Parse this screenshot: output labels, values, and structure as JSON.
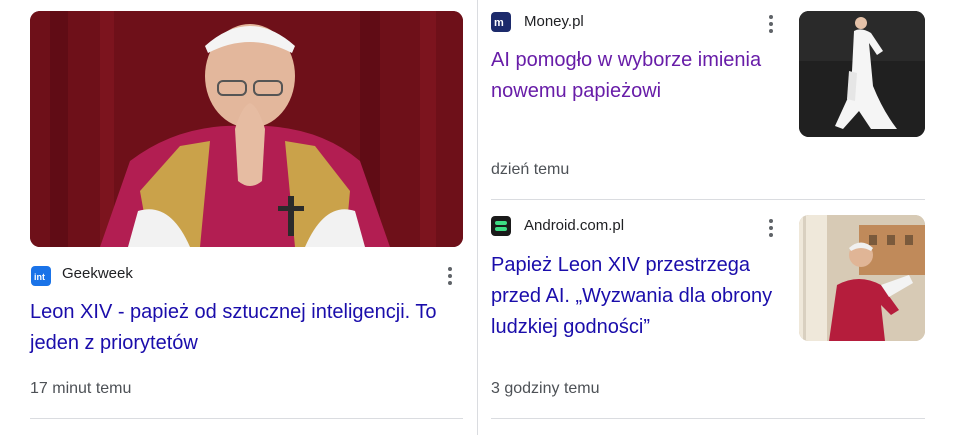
{
  "cards": [
    {
      "source": "Geekweek",
      "source_icon": "geekweek-logo-icon",
      "title": "Leon XIV - papież od sztucznej inteligencji. To jeden z priorytetów",
      "time": "17 minut temu",
      "image": "pope-praying-photo"
    },
    {
      "source": "Money.pl",
      "source_icon": "money-pl-logo-icon",
      "title": "AI pomogło w wyborze imienia nowemu papieżowi",
      "time": "dzień temu",
      "image": "pope-walking-photo"
    },
    {
      "source": "Android.com.pl",
      "source_icon": "android-com-pl-logo-icon",
      "title": "Papież Leon XIV przestrzega przed AI. „Wyzwania dla obrony ludzkiej godności”",
      "time": "3 godziny temu",
      "image": "pope-balcony-photo"
    }
  ],
  "colors": {
    "link": "#1a0dab",
    "visited_link": "#681da8",
    "meta_text": "#4d5156",
    "divider": "#dadce0"
  },
  "menu_icon": "more-vert-icon"
}
